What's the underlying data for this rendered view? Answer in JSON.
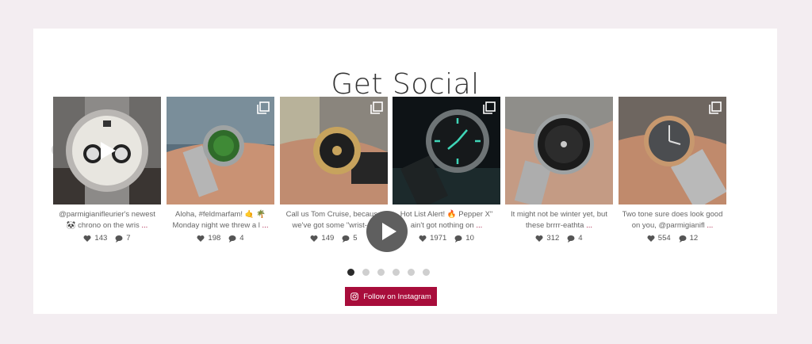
{
  "section": {
    "title": "Get Social"
  },
  "posts": [
    {
      "caption": "@parmigianifleurier's newest 🐼 chrono on the wris",
      "more": "...",
      "likes": "143",
      "comments": "7",
      "has_video": true
    },
    {
      "caption": "Aloha, #feldmarfam! 🤙 🌴 Monday night we threw a l",
      "more": "...",
      "likes": "198",
      "comments": "4",
      "multi": true
    },
    {
      "caption": "Call us Tom Cruise, because we've got some \"wrist-",
      "more": "...",
      "likes": "149",
      "comments": "5",
      "multi": true
    },
    {
      "caption": "Hot List Alert! 🔥 Pepper X\" ain't got nothing on",
      "more": "...",
      "likes": "1971",
      "comments": "10",
      "multi": true
    },
    {
      "caption": "It might not be winter yet, but these brrrr-eathta",
      "more": "...",
      "likes": "312",
      "comments": "4"
    },
    {
      "caption": "Two tone sure does look good on you, @parmigianifl",
      "more": "...",
      "likes": "554",
      "comments": "12",
      "multi": true
    }
  ],
  "carousel": {
    "prev_icon": "chevron-left-icon",
    "next_icon": "chevron-right-icon",
    "pages": 6,
    "active_page": 1
  },
  "follow_button": {
    "label": "Follow on Instagram",
    "icon": "instagram-icon"
  },
  "colors": {
    "accent": "#a80d3b",
    "background": "#f3edf1"
  }
}
